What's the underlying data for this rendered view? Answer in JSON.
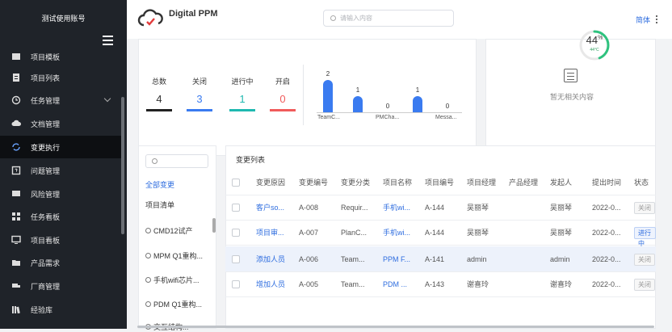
{
  "account": "测试使用账号",
  "app": {
    "brand": "Digital PPM"
  },
  "header": {
    "search_placeholder": "请输入内容",
    "lang": "简体"
  },
  "sidebar": {
    "items": [
      {
        "label": "项目模板",
        "icon": "template-icon"
      },
      {
        "label": "项目列表",
        "icon": "clipboard-icon"
      },
      {
        "label": "任务管理",
        "icon": "clock-icon"
      },
      {
        "label": "文档管理",
        "icon": "cloud-upload-icon"
      },
      {
        "label": "变更执行",
        "icon": "refresh-icon",
        "active": true
      },
      {
        "label": "问题管理",
        "icon": "question-icon"
      },
      {
        "label": "风险管理",
        "icon": "shield-icon"
      },
      {
        "label": "任务看板",
        "icon": "grid-icon"
      },
      {
        "label": "项目看板",
        "icon": "monitor-icon"
      },
      {
        "label": "产品需求",
        "icon": "folder-icon"
      },
      {
        "label": "厂商管理",
        "icon": "truck-icon"
      },
      {
        "label": "经验库",
        "icon": "library-icon"
      }
    ]
  },
  "stats": [
    {
      "label": "总数",
      "value": "4",
      "color": "#333333",
      "bar": "#222222"
    },
    {
      "label": "关闭",
      "value": "3",
      "color": "#3a7bf0",
      "bar": "#3a7bf0"
    },
    {
      "label": "进行中",
      "value": "1",
      "color": "#1fb9b0",
      "bar": "#1fb9b0"
    },
    {
      "label": "开启",
      "value": "0",
      "color": "#f05b5b",
      "bar": "#f05b5b"
    }
  ],
  "mini_chart": {
    "categories": [
      "TeamC...",
      "PMCha...",
      "Messa..."
    ],
    "values": [
      2,
      1,
      0,
      1,
      0
    ],
    "accent": "#3a7bf0"
  },
  "gauge": {
    "value": "44",
    "unit": "%",
    "sub": "44°C",
    "color": "#2ec27e"
  },
  "empty_text": "暂无相关内容",
  "left_panel": {
    "all": "全部变更",
    "list_title": "项目清单",
    "items": [
      "CMD12试产",
      "MPM Q1重构...",
      "手机wifi芯片...",
      "PDM Q1重构...",
      "交互结构..."
    ]
  },
  "table": {
    "title": "变更列表",
    "columns": [
      "变更原因",
      "变更编号",
      "变更分类",
      "项目名称",
      "项目编号",
      "项目经理",
      "产品经理",
      "发起人",
      "提出时间",
      "状态"
    ],
    "rows": [
      [
        "客户so...",
        "A-008",
        "Requir...",
        "手机wi...",
        "A-144",
        "吴丽琴",
        "",
        "吴丽琴",
        "2022-0...",
        "关闭"
      ],
      [
        "项目审...",
        "A-007",
        "PlanC...",
        "手机wi...",
        "A-144",
        "吴丽琴",
        "",
        "吴丽琴",
        "2022-0...",
        "进行中"
      ],
      [
        "添加人员",
        "A-006",
        "Team...",
        "PPM F...",
        "A-141",
        "admin",
        "",
        "admin",
        "2022-0...",
        "关闭"
      ],
      [
        "增加人员",
        "A-005",
        "Team...",
        "PDM ...",
        "A-143",
        "谢喜玲",
        "",
        "谢喜玲",
        "2022-0...",
        "关闭"
      ]
    ]
  }
}
